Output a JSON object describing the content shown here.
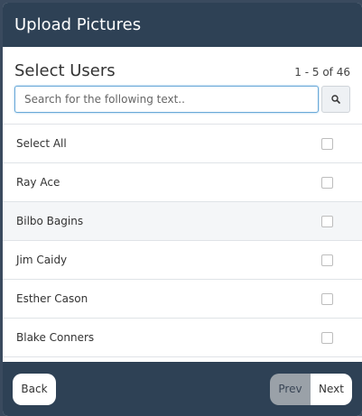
{
  "header": {
    "title": "Upload Pictures"
  },
  "main": {
    "title": "Select Users",
    "count": "1 - 5 of 46",
    "search": {
      "placeholder": "Search for the following text..",
      "value": "",
      "button_icon": "search-icon"
    },
    "select_all_label": "Select All",
    "users": [
      {
        "name": "Ray Ace",
        "checked": false
      },
      {
        "name": "Bilbo Bagins",
        "checked": false
      },
      {
        "name": "Jim Caidy",
        "checked": false
      },
      {
        "name": "Esther Cason",
        "checked": false
      },
      {
        "name": "Blake Conners",
        "checked": false
      }
    ]
  },
  "footer": {
    "back_label": "Back",
    "prev_label": "Prev",
    "next_label": "Next"
  },
  "colors": {
    "header_bg": "#2e4155",
    "focus_border": "#6aa9d8",
    "prev_disabled": "#9aa1a8"
  }
}
